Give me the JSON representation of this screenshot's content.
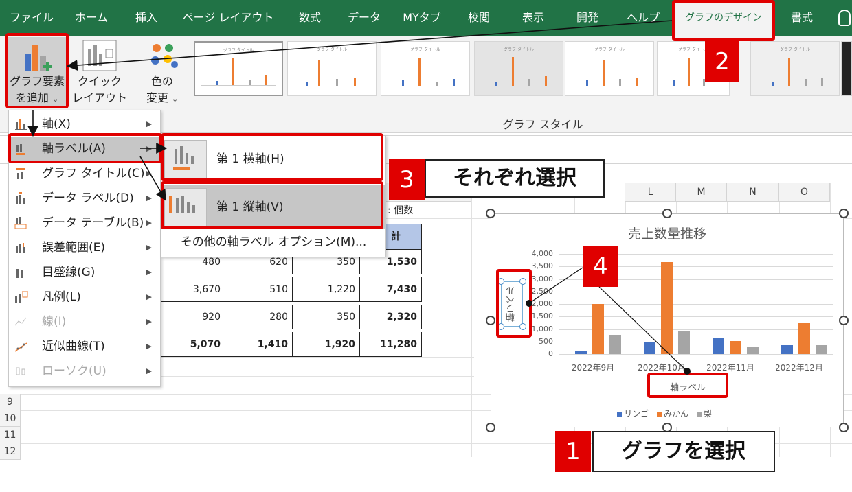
{
  "tabs": [
    {
      "label": "ファイル"
    },
    {
      "label": "ホーム"
    },
    {
      "label": "挿入"
    },
    {
      "label": "ページ レイアウト"
    },
    {
      "label": "数式"
    },
    {
      "label": "データ"
    },
    {
      "label": "MYタブ"
    },
    {
      "label": "校閲"
    },
    {
      "label": "表示"
    },
    {
      "label": "開発"
    },
    {
      "label": "ヘルプ"
    },
    {
      "label": "グラフのデザイン",
      "active": true
    },
    {
      "label": "書式"
    }
  ],
  "ribbon": {
    "add_element": {
      "line1": "グラフ要素",
      "line2": "を追加",
      "caret": "⌄"
    },
    "quick_layout": {
      "line1": "クイック",
      "line2": "レイアウト",
      "caret": "⌄"
    },
    "change_colors": {
      "line1": "色の",
      "line2": "変更",
      "caret": "⌄"
    },
    "style_group_label": "グラフ スタイル",
    "thumbnail_title": "グラフ タイトル"
  },
  "menu": {
    "items": [
      {
        "label": "軸(X)",
        "arrow": "▶",
        "disabled": false
      },
      {
        "label": "軸ラベル(A)",
        "arrow": "▶",
        "disabled": false,
        "highlighted": true
      },
      {
        "label": "グラフ タイトル(C)",
        "arrow": "▶",
        "disabled": false
      },
      {
        "label": "データ ラベル(D)",
        "arrow": "▶",
        "disabled": false
      },
      {
        "label": "データ テーブル(B)",
        "arrow": "▶",
        "disabled": false
      },
      {
        "label": "誤差範囲(E)",
        "arrow": "▶",
        "disabled": false
      },
      {
        "label": "目盛線(G)",
        "arrow": "▶",
        "disabled": false
      },
      {
        "label": "凡例(L)",
        "arrow": "▶",
        "disabled": false
      },
      {
        "label": "線(I)",
        "arrow": "▶",
        "disabled": true
      },
      {
        "label": "近似曲線(T)",
        "arrow": "▶",
        "disabled": false
      },
      {
        "label": "ローソク(U)",
        "arrow": "▶",
        "disabled": true
      }
    ]
  },
  "submenu": {
    "primary_horizontal": "第 1 横軸(H)",
    "primary_vertical": "第 1 縦軸(V)",
    "more_options": "その他の軸ラベル オプション(M)..."
  },
  "sheet": {
    "columns": [
      "L",
      "M",
      "N",
      "O"
    ],
    "unit_label": ": 個数",
    "total_header": "計",
    "rows": [
      "9",
      "10",
      "11",
      "12"
    ],
    "table": [
      [
        "480",
        "620",
        "350",
        "1,530"
      ],
      [
        "3,670",
        "510",
        "1,220",
        "7,430"
      ],
      [
        "920",
        "280",
        "350",
        "2,320"
      ],
      [
        "5,070",
        "1,410",
        "1,920",
        "11,280"
      ]
    ]
  },
  "chart_data": {
    "type": "bar",
    "title": "売上数量推移",
    "categories": [
      "2022年9月",
      "2022年10月",
      "2022年11月",
      "2022年12月"
    ],
    "series": [
      {
        "name": "リンゴ",
        "color": "#4472c4",
        "values": [
          100,
          480,
          620,
          350
        ]
      },
      {
        "name": "みかん",
        "color": "#ed7d31",
        "values": [
          2000,
          3670,
          510,
          1220
        ]
      },
      {
        "name": "梨",
        "color": "#a5a5a5",
        "values": [
          760,
          920,
          280,
          350
        ]
      }
    ],
    "yticks": [
      "4,000",
      "3,500",
      "3,000",
      "2,500",
      "2,000",
      "1,500",
      "1,000",
      "500",
      "0"
    ],
    "ylim": [
      0,
      4000
    ],
    "xlabel": "軸ラベル",
    "ylabel": "軸ラベル",
    "grid": true,
    "legend_position": "bottom"
  },
  "annotations": {
    "step1": {
      "num": "1",
      "text": "グラフを選択"
    },
    "step2": {
      "num": "2"
    },
    "step3": {
      "num": "3",
      "text": "それぞれ選択"
    },
    "step4": {
      "num": "4"
    }
  },
  "colors": {
    "excel_green": "#217346",
    "annotation_red": "#e00000"
  }
}
